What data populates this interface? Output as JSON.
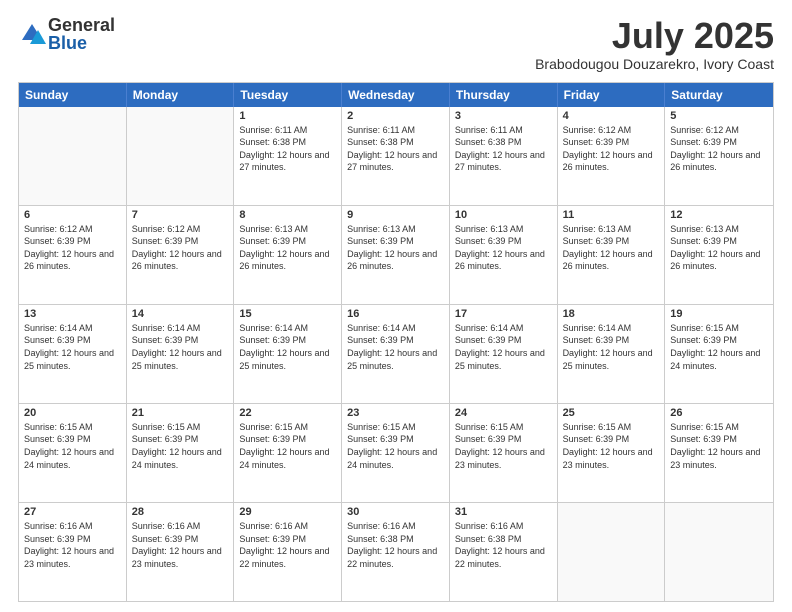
{
  "logo": {
    "general": "General",
    "blue": "Blue"
  },
  "title": "July 2025",
  "subtitle": "Brabodougou Douzarekro, Ivory Coast",
  "header_days": [
    "Sunday",
    "Monday",
    "Tuesday",
    "Wednesday",
    "Thursday",
    "Friday",
    "Saturday"
  ],
  "weeks": [
    [
      {
        "day": "",
        "info": ""
      },
      {
        "day": "",
        "info": ""
      },
      {
        "day": "1",
        "info": "Sunrise: 6:11 AM\nSunset: 6:38 PM\nDaylight: 12 hours and 27 minutes."
      },
      {
        "day": "2",
        "info": "Sunrise: 6:11 AM\nSunset: 6:38 PM\nDaylight: 12 hours and 27 minutes."
      },
      {
        "day": "3",
        "info": "Sunrise: 6:11 AM\nSunset: 6:38 PM\nDaylight: 12 hours and 27 minutes."
      },
      {
        "day": "4",
        "info": "Sunrise: 6:12 AM\nSunset: 6:39 PM\nDaylight: 12 hours and 26 minutes."
      },
      {
        "day": "5",
        "info": "Sunrise: 6:12 AM\nSunset: 6:39 PM\nDaylight: 12 hours and 26 minutes."
      }
    ],
    [
      {
        "day": "6",
        "info": "Sunrise: 6:12 AM\nSunset: 6:39 PM\nDaylight: 12 hours and 26 minutes."
      },
      {
        "day": "7",
        "info": "Sunrise: 6:12 AM\nSunset: 6:39 PM\nDaylight: 12 hours and 26 minutes."
      },
      {
        "day": "8",
        "info": "Sunrise: 6:13 AM\nSunset: 6:39 PM\nDaylight: 12 hours and 26 minutes."
      },
      {
        "day": "9",
        "info": "Sunrise: 6:13 AM\nSunset: 6:39 PM\nDaylight: 12 hours and 26 minutes."
      },
      {
        "day": "10",
        "info": "Sunrise: 6:13 AM\nSunset: 6:39 PM\nDaylight: 12 hours and 26 minutes."
      },
      {
        "day": "11",
        "info": "Sunrise: 6:13 AM\nSunset: 6:39 PM\nDaylight: 12 hours and 26 minutes."
      },
      {
        "day": "12",
        "info": "Sunrise: 6:13 AM\nSunset: 6:39 PM\nDaylight: 12 hours and 26 minutes."
      }
    ],
    [
      {
        "day": "13",
        "info": "Sunrise: 6:14 AM\nSunset: 6:39 PM\nDaylight: 12 hours and 25 minutes."
      },
      {
        "day": "14",
        "info": "Sunrise: 6:14 AM\nSunset: 6:39 PM\nDaylight: 12 hours and 25 minutes."
      },
      {
        "day": "15",
        "info": "Sunrise: 6:14 AM\nSunset: 6:39 PM\nDaylight: 12 hours and 25 minutes."
      },
      {
        "day": "16",
        "info": "Sunrise: 6:14 AM\nSunset: 6:39 PM\nDaylight: 12 hours and 25 minutes."
      },
      {
        "day": "17",
        "info": "Sunrise: 6:14 AM\nSunset: 6:39 PM\nDaylight: 12 hours and 25 minutes."
      },
      {
        "day": "18",
        "info": "Sunrise: 6:14 AM\nSunset: 6:39 PM\nDaylight: 12 hours and 25 minutes."
      },
      {
        "day": "19",
        "info": "Sunrise: 6:15 AM\nSunset: 6:39 PM\nDaylight: 12 hours and 24 minutes."
      }
    ],
    [
      {
        "day": "20",
        "info": "Sunrise: 6:15 AM\nSunset: 6:39 PM\nDaylight: 12 hours and 24 minutes."
      },
      {
        "day": "21",
        "info": "Sunrise: 6:15 AM\nSunset: 6:39 PM\nDaylight: 12 hours and 24 minutes."
      },
      {
        "day": "22",
        "info": "Sunrise: 6:15 AM\nSunset: 6:39 PM\nDaylight: 12 hours and 24 minutes."
      },
      {
        "day": "23",
        "info": "Sunrise: 6:15 AM\nSunset: 6:39 PM\nDaylight: 12 hours and 24 minutes."
      },
      {
        "day": "24",
        "info": "Sunrise: 6:15 AM\nSunset: 6:39 PM\nDaylight: 12 hours and 23 minutes."
      },
      {
        "day": "25",
        "info": "Sunrise: 6:15 AM\nSunset: 6:39 PM\nDaylight: 12 hours and 23 minutes."
      },
      {
        "day": "26",
        "info": "Sunrise: 6:15 AM\nSunset: 6:39 PM\nDaylight: 12 hours and 23 minutes."
      }
    ],
    [
      {
        "day": "27",
        "info": "Sunrise: 6:16 AM\nSunset: 6:39 PM\nDaylight: 12 hours and 23 minutes."
      },
      {
        "day": "28",
        "info": "Sunrise: 6:16 AM\nSunset: 6:39 PM\nDaylight: 12 hours and 23 minutes."
      },
      {
        "day": "29",
        "info": "Sunrise: 6:16 AM\nSunset: 6:39 PM\nDaylight: 12 hours and 22 minutes."
      },
      {
        "day": "30",
        "info": "Sunrise: 6:16 AM\nSunset: 6:38 PM\nDaylight: 12 hours and 22 minutes."
      },
      {
        "day": "31",
        "info": "Sunrise: 6:16 AM\nSunset: 6:38 PM\nDaylight: 12 hours and 22 minutes."
      },
      {
        "day": "",
        "info": ""
      },
      {
        "day": "",
        "info": ""
      }
    ]
  ]
}
